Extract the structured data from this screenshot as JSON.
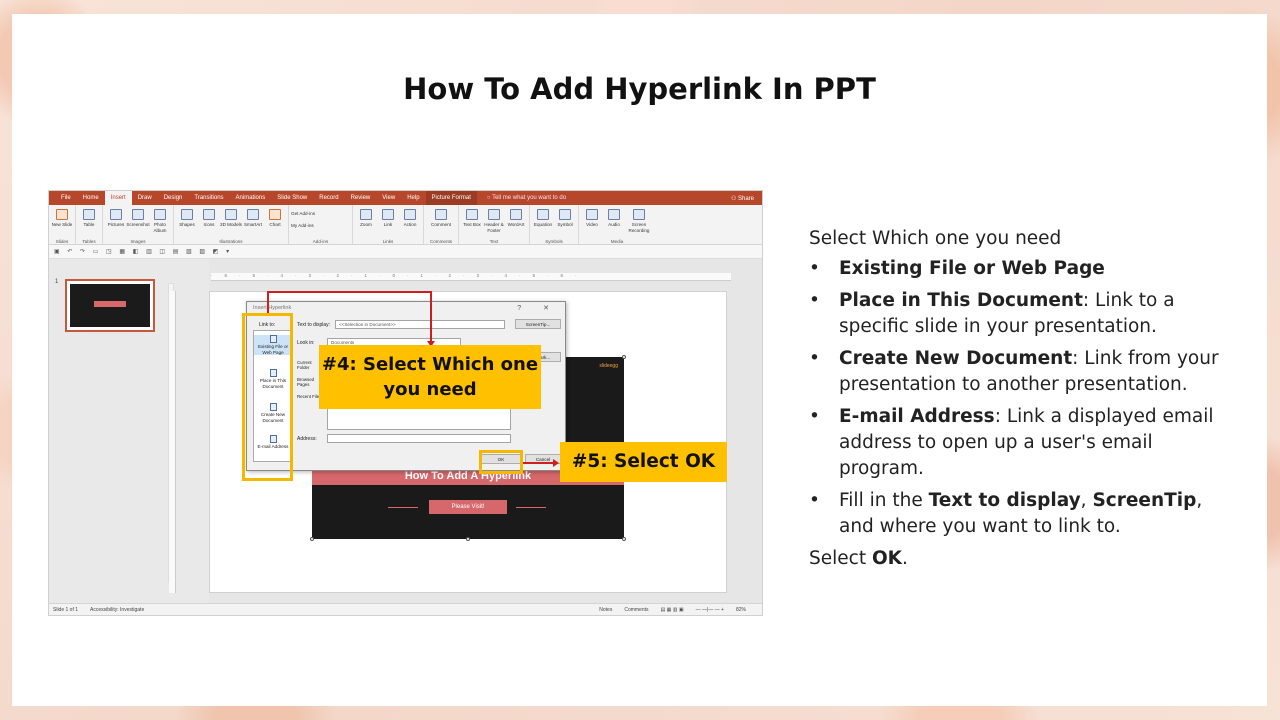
{
  "slide": {
    "title": "How To Add Hyperlink In PPT"
  },
  "ppt": {
    "tabs": [
      "File",
      "Home",
      "Insert",
      "Draw",
      "Design",
      "Transitions",
      "Animations",
      "Slide Show",
      "Record",
      "Review",
      "View",
      "Help",
      "Picture Format"
    ],
    "active_tab": "Insert",
    "tell_me": "Tell me what you want to do",
    "share": "Share",
    "ribbon_groups": [
      {
        "name": "Slides",
        "buttons": [
          "New Slide"
        ]
      },
      {
        "name": "Tables",
        "buttons": [
          "Table"
        ]
      },
      {
        "name": "Images",
        "buttons": [
          "Pictures",
          "Screenshot",
          "Photo Album"
        ]
      },
      {
        "name": "Illustrations",
        "buttons": [
          "Shapes",
          "Icons",
          "3D Models",
          "SmartArt",
          "Chart"
        ]
      },
      {
        "name": "Add-ins",
        "buttons": [
          "Get Add-ins",
          "My Add-ins"
        ]
      },
      {
        "name": "Links",
        "buttons": [
          "Zoom",
          "Link",
          "Action"
        ]
      },
      {
        "name": "Comments",
        "buttons": [
          "Comment"
        ]
      },
      {
        "name": "Text",
        "buttons": [
          "Text Box",
          "Header & Footer",
          "WordArt"
        ]
      },
      {
        "name": "Symbols",
        "buttons": [
          "Equation",
          "Symbol"
        ]
      },
      {
        "name": "Media",
        "buttons": [
          "Video",
          "Audio",
          "Screen Recording"
        ]
      }
    ],
    "slide_number": "1",
    "slide_content": {
      "logo": "slideegg",
      "banner": "How To Add A Hyperlink",
      "button": "Please Visit!"
    },
    "dialog": {
      "title": "Insert Hyperlink",
      "controls": "? ✕",
      "link_to_label": "Link to:",
      "link_to": [
        "Existing File or Web Page",
        "Place in This Document",
        "Create New Document",
        "E-mail Address"
      ],
      "text_to_display_label": "Text to display:",
      "text_to_display_value": "<<Selection in Document>>",
      "screentip": "ScreenTip...",
      "look_in_label": "Look in:",
      "look_in_value": "Documents",
      "nav": [
        "Current Folder",
        "Browsed Pages",
        "Recent Files"
      ],
      "bookmark": "Bookmark...",
      "address_label": "Address:",
      "ok": "OK",
      "cancel": "Cancel"
    },
    "callout_4": "#4: Select Which one you need",
    "callout_5": "#5: Select OK",
    "status": {
      "slide_of": "Slide 1 of 1",
      "accessibility": "Accessibility: Investigate",
      "notes": "Notes",
      "comments": "Comments",
      "zoom": "82%"
    },
    "accent_color": "#b7472a",
    "callout_color": "#ffc000"
  },
  "instructions": {
    "intro": "Select Which one you need",
    "items": [
      {
        "bold": "Existing File or Web Page",
        "rest": ""
      },
      {
        "bold": "Place in This Document",
        "rest": ": Link to a specific slide in your presentation."
      },
      {
        "bold": "Create New Document",
        "rest": ": Link from your presentation to another presentation."
      },
      {
        "bold": "E-mail Address",
        "rest": ": Link a displayed email address to open up a user's email program."
      }
    ],
    "fill_prefix": "Fill in the ",
    "fill_bold1": "Text to display",
    "fill_sep": ", ",
    "fill_bold2": "ScreenTip",
    "fill_suffix": ", and where you want to link to.",
    "outro_prefix": "Select ",
    "outro_bold": "OK",
    "outro_suffix": "."
  }
}
